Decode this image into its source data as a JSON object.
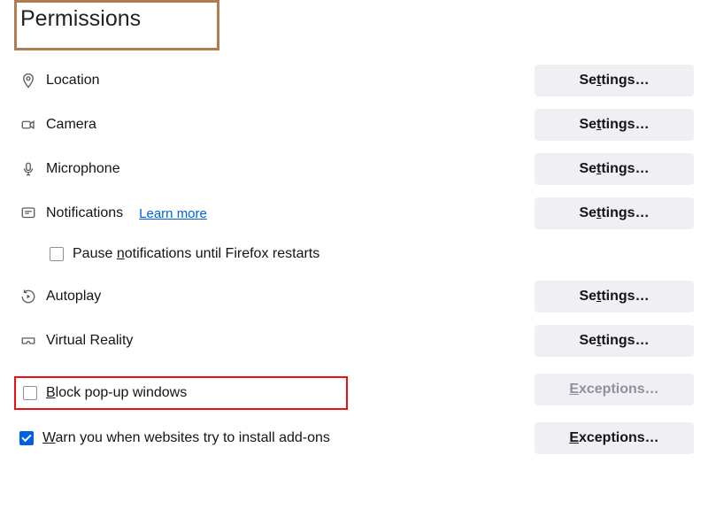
{
  "section_title": "Permissions",
  "rows": {
    "location": {
      "label": "Location",
      "button": "Settings…"
    },
    "camera": {
      "label": "Camera",
      "button": "Settings…"
    },
    "microphone": {
      "label": "Microphone",
      "button": "Settings…"
    },
    "notifications": {
      "label": "Notifications",
      "link": "Learn more",
      "button": "Settings…"
    },
    "autoplay": {
      "label": "Autoplay",
      "button": "Settings…"
    },
    "vr": {
      "label": "Virtual Reality",
      "button": "Settings…"
    }
  },
  "pause_notifications_label": "Pause notifications until Firefox restarts",
  "block_popups_label": "Block pop-up windows",
  "block_popups_button": "Exceptions…",
  "warn_addons_label": "Warn you when websites try to install add-ons",
  "warn_addons_button": "Exceptions…"
}
